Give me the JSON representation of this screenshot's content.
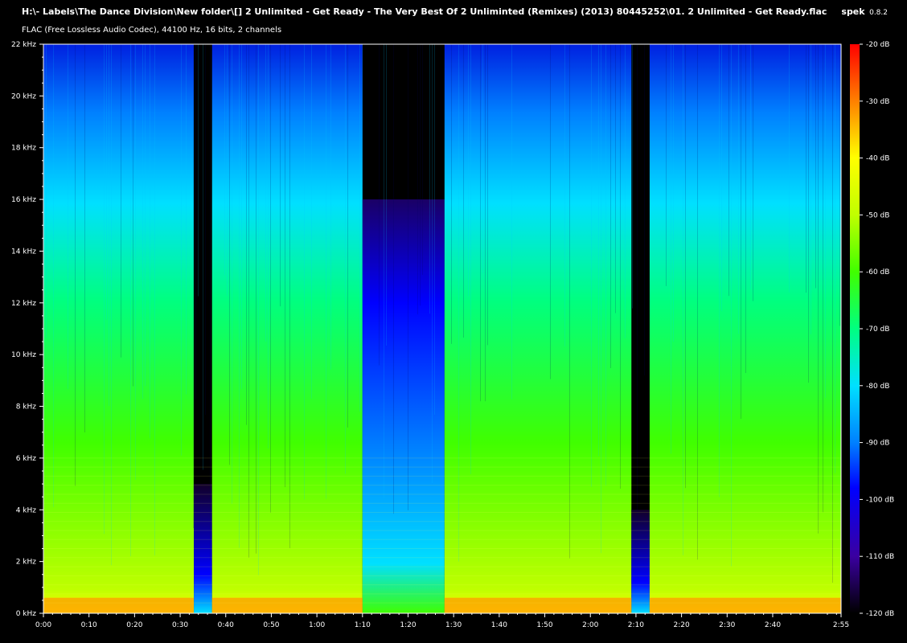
{
  "header": {
    "file_path": "H:\\- Labels\\The Dance Division\\New folder\\[] 2 Unlimited - Get Ready - The Very Best Of 2 Unliminted (Remixes) (2013) 80445252\\01. 2 Unlimited - Get Ready.flac",
    "stream_info": "FLAC (Free Lossless Audio Codec), 44100 Hz, 16 bits, 2 channels",
    "app_name": "spek",
    "app_version": "0.8.2"
  },
  "chart_data": {
    "type": "heatmap",
    "x_unit": "time (m:ss)",
    "y_unit": "frequency (kHz)",
    "xlim_seconds": [
      0,
      175
    ],
    "ylim_khz": [
      0,
      22
    ],
    "x_ticks": [
      "0:00",
      "0:10",
      "0:20",
      "0:30",
      "0:40",
      "0:50",
      "1:00",
      "1:10",
      "1:20",
      "1:30",
      "1:40",
      "1:50",
      "2:00",
      "2:10",
      "2:20",
      "2:30",
      "2:40",
      "2:55"
    ],
    "x_tick_seconds": [
      0,
      10,
      20,
      30,
      40,
      50,
      60,
      70,
      80,
      90,
      100,
      110,
      120,
      130,
      140,
      150,
      160,
      175
    ],
    "y_ticks": [
      "0 kHz",
      "2 kHz",
      "4 kHz",
      "6 kHz",
      "8 kHz",
      "10 kHz",
      "12 kHz",
      "14 kHz",
      "16 kHz",
      "18 kHz",
      "20 kHz",
      "22 kHz"
    ],
    "y_tick_khz": [
      0,
      2,
      4,
      6,
      8,
      10,
      12,
      14,
      16,
      18,
      20,
      22
    ],
    "colorbar_ticks": [
      "-20 dB",
      "-30 dB",
      "-40 dB",
      "-50 dB",
      "-60 dB",
      "-70 dB",
      "-80 dB",
      "-90 dB",
      "-100 dB",
      "-110 dB",
      "-120 dB"
    ],
    "colorbar_db": [
      -20,
      -30,
      -40,
      -50,
      -60,
      -70,
      -80,
      -90,
      -100,
      -110,
      -120
    ],
    "db_range": [
      -120,
      -20
    ],
    "segments": [
      {
        "start_s": 0,
        "end_s": 33,
        "level": "loud",
        "cutoff_khz": 22
      },
      {
        "start_s": 33,
        "end_s": 37,
        "level": "quiet",
        "cutoff_khz": 5
      },
      {
        "start_s": 37,
        "end_s": 70,
        "level": "loud",
        "cutoff_khz": 22
      },
      {
        "start_s": 70,
        "end_s": 88,
        "level": "break",
        "cutoff_khz": 16
      },
      {
        "start_s": 88,
        "end_s": 129,
        "level": "loud",
        "cutoff_khz": 22
      },
      {
        "start_s": 129,
        "end_s": 133,
        "level": "quiet",
        "cutoff_khz": 4
      },
      {
        "start_s": 133,
        "end_s": 175,
        "level": "loud",
        "cutoff_khz": 22
      }
    ],
    "colorscale": [
      "#000000",
      "#1a0033",
      "#3a00a0",
      "#0000ff",
      "#0080ff",
      "#00e0ff",
      "#00ff80",
      "#40ff00",
      "#c0ff00",
      "#ffff00",
      "#ff8000",
      "#ff0000"
    ]
  }
}
